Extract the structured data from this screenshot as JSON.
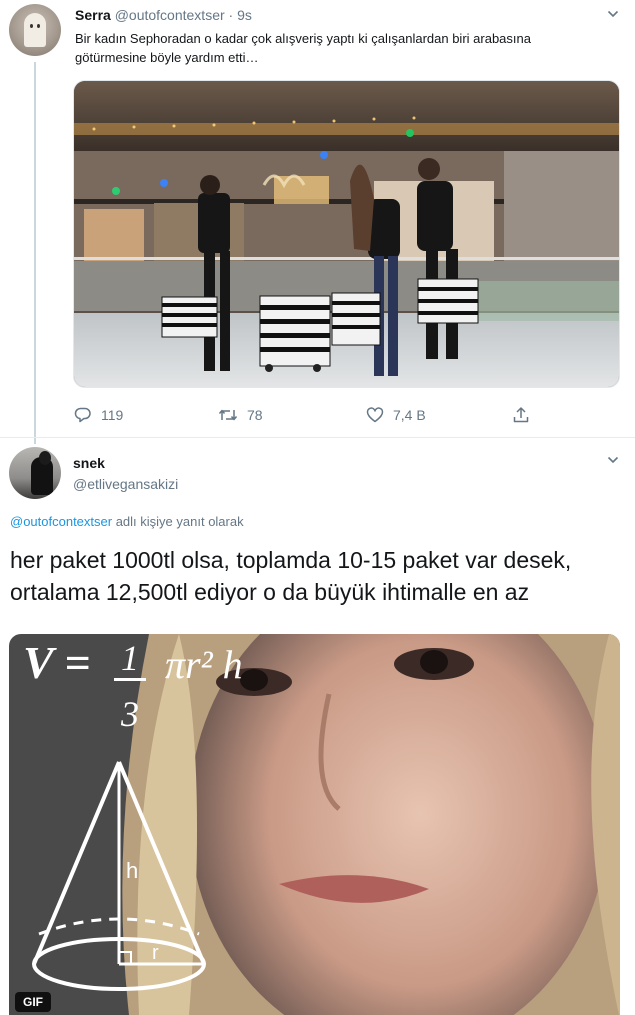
{
  "tweet": {
    "author_name": "Serra",
    "author_handle": "@outofcontextser",
    "time": "· 9s",
    "text": "Bir kadın Sephoradan o kadar çok alışveriş yaptı ki çalışanlardan biri arabasına götürmesine böyle yardım etti…",
    "media": {
      "icon": "video-thumbnail"
    },
    "actions": {
      "reply_count": "119",
      "retweet_count": "78",
      "like_count": "7,4 B",
      "reply_icon": "reply-icon",
      "retweet_icon": "retweet-icon",
      "like_icon": "heart-icon",
      "share_icon": "share-icon"
    }
  },
  "reply": {
    "author_name": "snek",
    "author_handle": "@etlivegansakizi",
    "replying_mention": "@outofcontextser",
    "replying_suffix": " adlı kişiye yanıt olarak",
    "text": "her paket 1000tl olsa, toplamda 10-15 paket var desek, ortalama 12,500tl ediyor o da büyük ihtimalle en az",
    "media_badge": "GIF",
    "media_formula_v": "V =",
    "media_formula_num": "1",
    "media_formula_den": "3",
    "media_formula_rest": "πr² h",
    "media_label_h": "h",
    "media_label_r": "r"
  },
  "colors": {
    "accent": "#1b95e0",
    "secondary_text": "#657786",
    "divider": "#e6ecf0"
  }
}
